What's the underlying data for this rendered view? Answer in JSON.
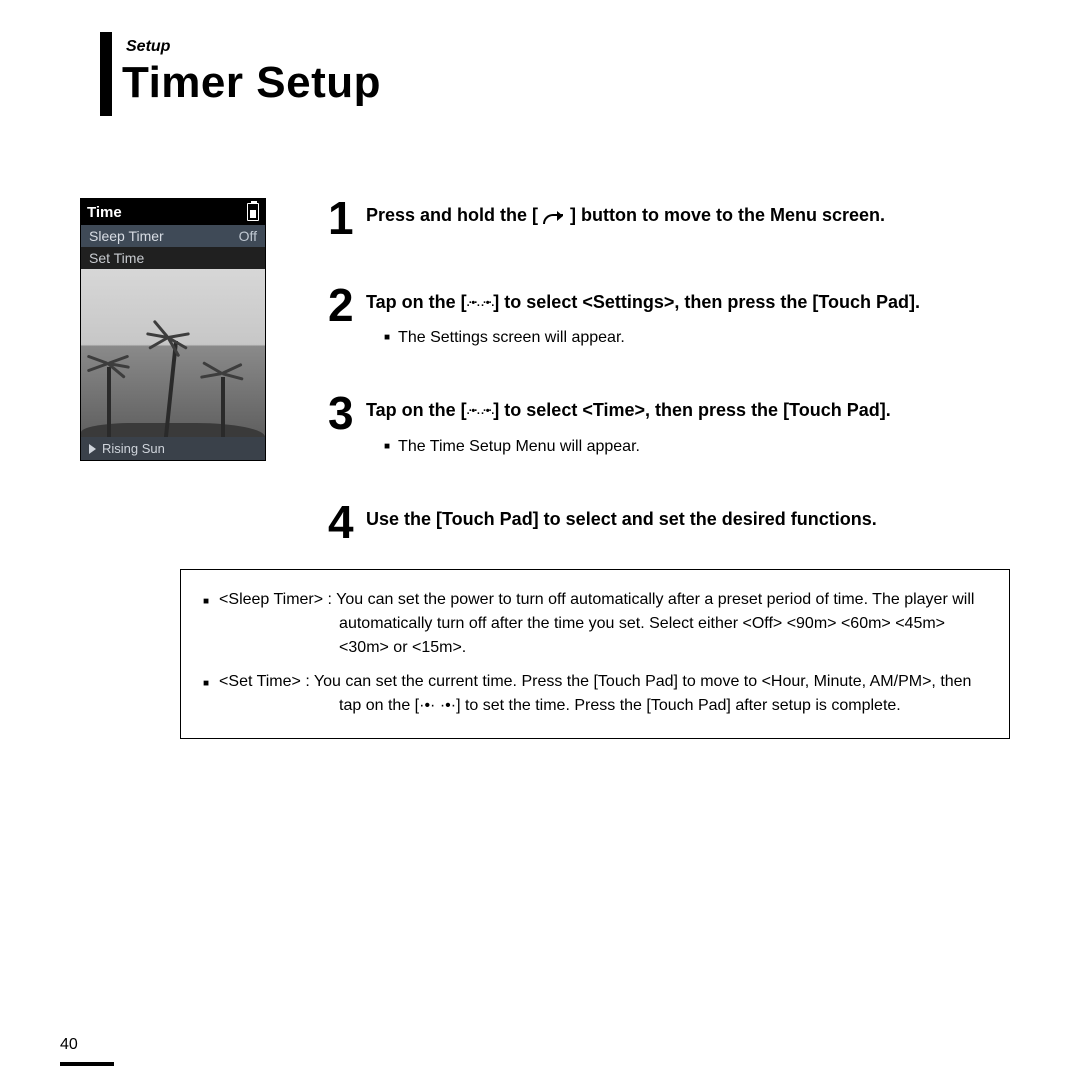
{
  "header": {
    "eyebrow": "Setup",
    "title": "Timer Setup"
  },
  "device": {
    "title": "Time",
    "rows": [
      {
        "label": "Sleep Timer",
        "value": "Off",
        "selected": true
      },
      {
        "label": "Set Time",
        "value": "",
        "selected": false
      }
    ],
    "nowplaying": "Rising Sun"
  },
  "steps": [
    {
      "num": "1",
      "lead_pre": "Press and hold the [ ",
      "lead_icon": "back",
      "lead_post": " ] button to move to the Menu screen."
    },
    {
      "num": "2",
      "lead_pre": "Tap on the [",
      "lead_icon": "updown",
      "lead_post": "] to select <Settings>,  then press the [Touch Pad].",
      "sub": "The Settings screen will appear."
    },
    {
      "num": "3",
      "lead_pre": "Tap on the [",
      "lead_icon": "updown",
      "lead_post": "] to select <Time>,  then press the [Touch Pad].",
      "sub": "The Time Setup Menu will appear."
    },
    {
      "num": "4",
      "lead_pre": "Use the [Touch Pad] to select and set the desired functions.",
      "lead_icon": "",
      "lead_post": ""
    }
  ],
  "details": [
    {
      "label": "<Sleep Timer> : ",
      "text": "You can set the power to turn off automatically after a preset period of time. The player will automatically turn off after the time you set. Select either <Off> <90m> <60m> <45m> <30m> or <15m>."
    },
    {
      "label": "<Set Time> : ",
      "text": "You can set the current time. Press the [Touch Pad] to move to <Hour, Minute, AM/PM>, then tap on the [·•· ·•·] to set the time. Press the [Touch Pad] after setup is complete."
    }
  ],
  "page_number": "40"
}
